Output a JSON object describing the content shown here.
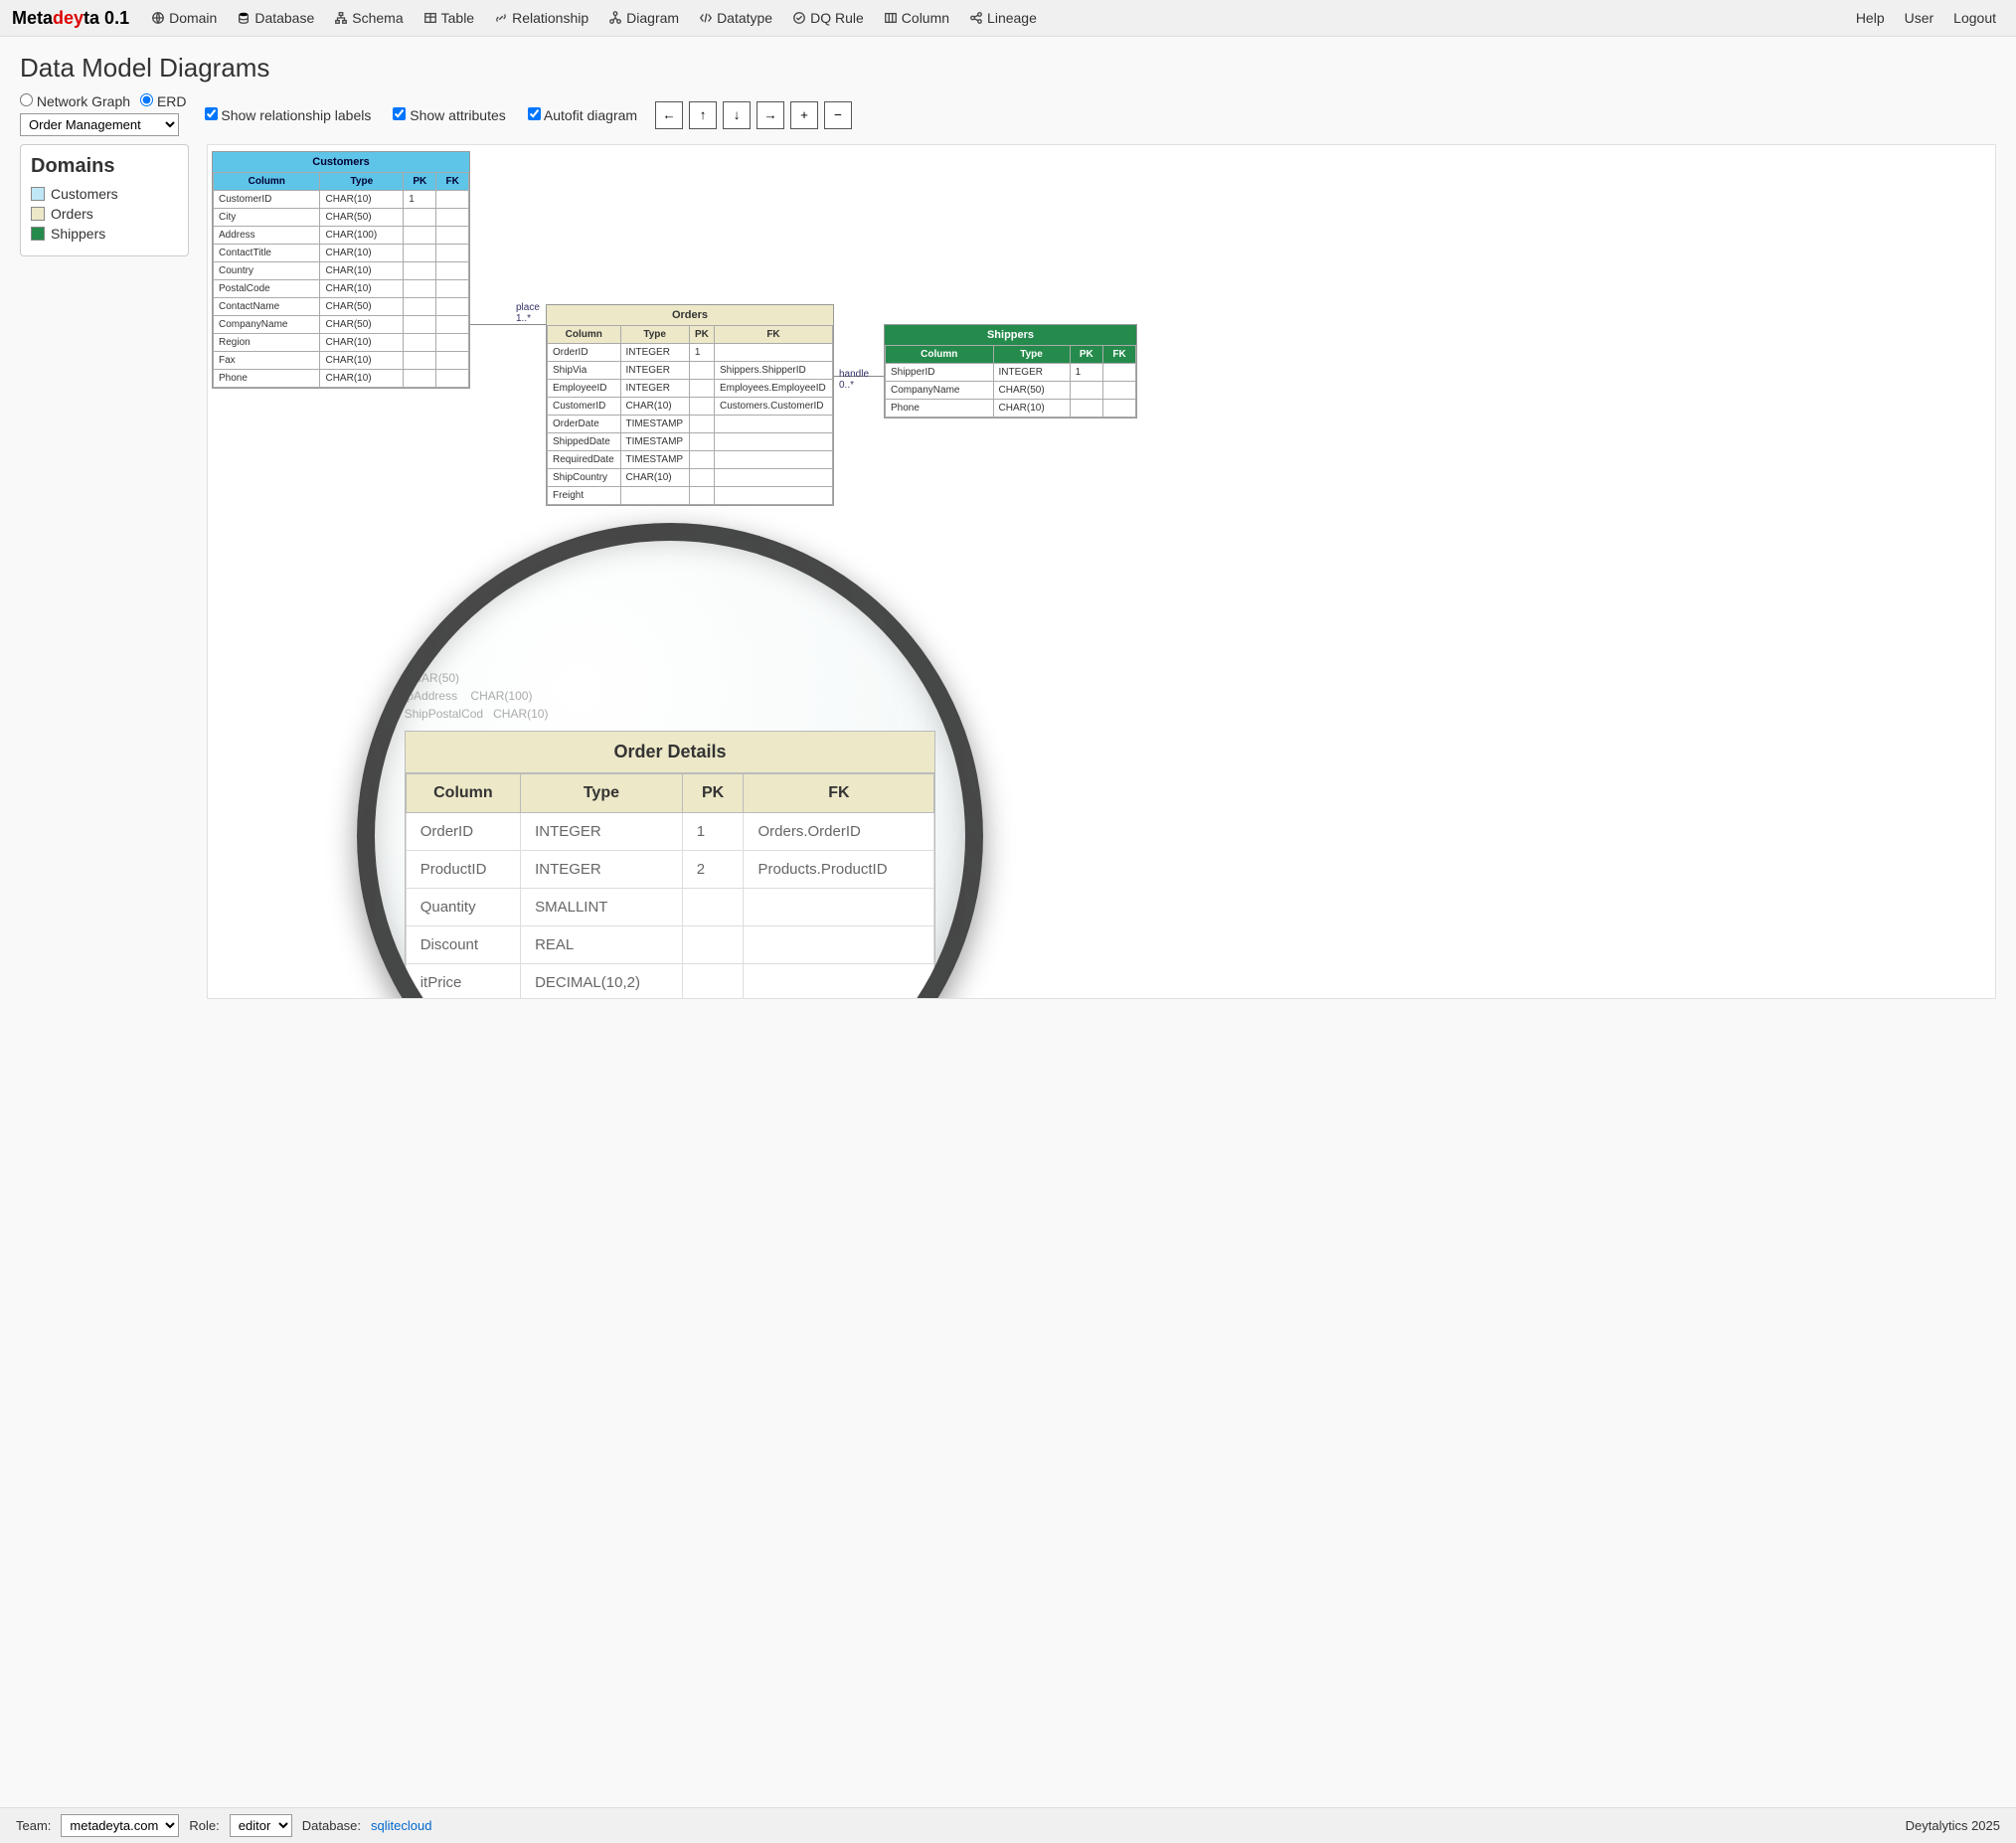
{
  "brand": {
    "p1": "Meta",
    "p2": "dey",
    "p3": "ta 0.1"
  },
  "nav": {
    "items": [
      {
        "label": "Domain"
      },
      {
        "label": "Database"
      },
      {
        "label": "Schema"
      },
      {
        "label": "Table"
      },
      {
        "label": "Relationship"
      },
      {
        "label": "Diagram"
      },
      {
        "label": "Datatype"
      },
      {
        "label": "DQ Rule"
      },
      {
        "label": "Column"
      },
      {
        "label": "Lineage"
      }
    ],
    "right": [
      {
        "label": "Help"
      },
      {
        "label": "User"
      },
      {
        "label": "Logout"
      }
    ]
  },
  "page_title": "Data Model Diagrams",
  "controls": {
    "radio_network": "Network Graph",
    "radio_erd": "ERD",
    "domain_select": "Order Management",
    "chk_rel": "Show relationship labels",
    "chk_attr": "Show attributes",
    "chk_autofit": "Autofit diagram",
    "btn_left": "←",
    "btn_up": "↑",
    "btn_down": "↓",
    "btn_right": "→",
    "btn_plus": "+",
    "btn_minus": "−"
  },
  "domains_panel": {
    "heading": "Domains",
    "items": [
      {
        "label": "Customers",
        "color": "#bfe7f5"
      },
      {
        "label": "Orders",
        "color": "#ece8c8"
      },
      {
        "label": "Shippers",
        "color": "#258b4c"
      }
    ]
  },
  "col_headers": {
    "col": "Column",
    "type": "Type",
    "pk": "PK",
    "fk": "FK"
  },
  "entities": {
    "customers": {
      "title": "Customers",
      "rows": [
        {
          "c": "CustomerID",
          "t": "CHAR(10)",
          "pk": "1",
          "fk": ""
        },
        {
          "c": "City",
          "t": "CHAR(50)",
          "pk": "",
          "fk": ""
        },
        {
          "c": "Address",
          "t": "CHAR(100)",
          "pk": "",
          "fk": ""
        },
        {
          "c": "ContactTitle",
          "t": "CHAR(10)",
          "pk": "",
          "fk": ""
        },
        {
          "c": "Country",
          "t": "CHAR(10)",
          "pk": "",
          "fk": ""
        },
        {
          "c": "PostalCode",
          "t": "CHAR(10)",
          "pk": "",
          "fk": ""
        },
        {
          "c": "ContactName",
          "t": "CHAR(50)",
          "pk": "",
          "fk": ""
        },
        {
          "c": "CompanyName",
          "t": "CHAR(50)",
          "pk": "",
          "fk": ""
        },
        {
          "c": "Region",
          "t": "CHAR(10)",
          "pk": "",
          "fk": ""
        },
        {
          "c": "Fax",
          "t": "CHAR(10)",
          "pk": "",
          "fk": ""
        },
        {
          "c": "Phone",
          "t": "CHAR(10)",
          "pk": "",
          "fk": ""
        }
      ]
    },
    "orders": {
      "title": "Orders",
      "rows": [
        {
          "c": "OrderID",
          "t": "INTEGER",
          "pk": "1",
          "fk": ""
        },
        {
          "c": "ShipVia",
          "t": "INTEGER",
          "pk": "",
          "fk": "Shippers.ShipperID"
        },
        {
          "c": "EmployeeID",
          "t": "INTEGER",
          "pk": "",
          "fk": "Employees.EmployeeID"
        },
        {
          "c": "CustomerID",
          "t": "CHAR(10)",
          "pk": "",
          "fk": "Customers.CustomerID"
        },
        {
          "c": "OrderDate",
          "t": "TIMESTAMP",
          "pk": "",
          "fk": ""
        },
        {
          "c": "ShippedDate",
          "t": "TIMESTAMP",
          "pk": "",
          "fk": ""
        },
        {
          "c": "RequiredDate",
          "t": "TIMESTAMP",
          "pk": "",
          "fk": ""
        },
        {
          "c": "ShipCountry",
          "t": "CHAR(10)",
          "pk": "",
          "fk": ""
        },
        {
          "c": "Freight",
          "t": "",
          "pk": "",
          "fk": ""
        }
      ]
    },
    "shippers": {
      "title": "Shippers",
      "rows": [
        {
          "c": "ShipperID",
          "t": "INTEGER",
          "pk": "1",
          "fk": ""
        },
        {
          "c": "CompanyName",
          "t": "CHAR(50)",
          "pk": "",
          "fk": ""
        },
        {
          "c": "Phone",
          "t": "CHAR(10)",
          "pk": "",
          "fk": ""
        }
      ]
    }
  },
  "relationships": {
    "place": {
      "label": "place",
      "card": "1..*"
    },
    "handle": {
      "label": "handle",
      "card": "0..*"
    }
  },
  "magnified_partial": [
    {
      "c": "",
      "t": "CHAR(50)"
    },
    {
      "c": "ipAddress",
      "t": "CHAR(100)"
    },
    {
      "c": "ShipPostalCod",
      "t": "CHAR(10)"
    }
  ],
  "order_details": {
    "title": "Order Details",
    "rows": [
      {
        "c": "OrderID",
        "t": "INTEGER",
        "pk": "1",
        "fk": "Orders.OrderID"
      },
      {
        "c": "ProductID",
        "t": "INTEGER",
        "pk": "2",
        "fk": "Products.ProductID"
      },
      {
        "c": "Quantity",
        "t": "SMALLINT",
        "pk": "",
        "fk": ""
      },
      {
        "c": "Discount",
        "t": "REAL",
        "pk": "",
        "fk": ""
      },
      {
        "c": "itPrice",
        "t": "DECIMAL(10,2)",
        "pk": "",
        "fk": ""
      }
    ]
  },
  "footer": {
    "team_label": "Team:",
    "team_value": "metadeyta.com",
    "role_label": "Role:",
    "role_value": "editor",
    "db_label": "Database:",
    "db_value": "sqlitecloud",
    "copyright": "Deytalytics 2025"
  }
}
